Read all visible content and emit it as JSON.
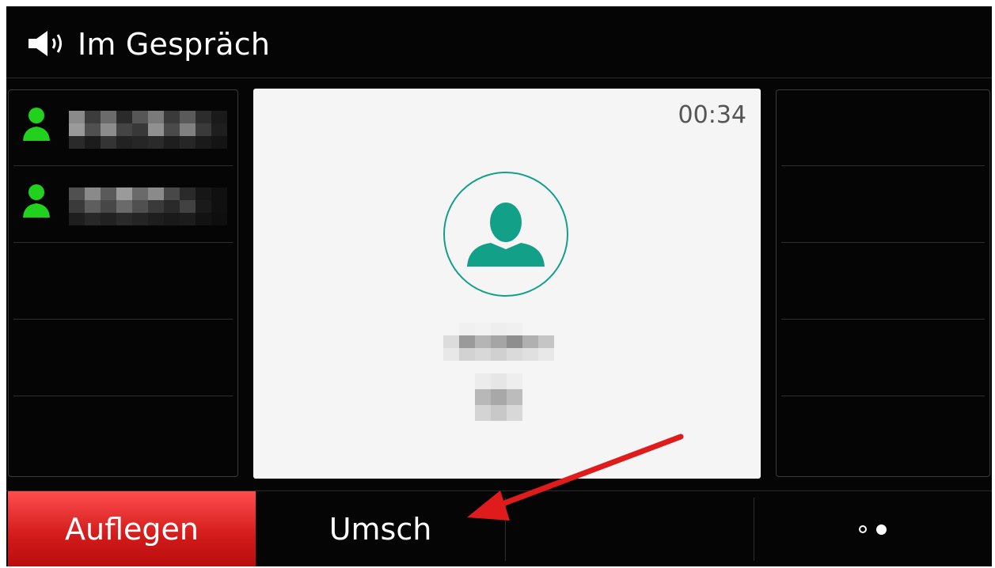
{
  "header": {
    "status_icon": "speaker-icon",
    "title": "Im Gespräch"
  },
  "call_lines": [
    {
      "icon": "person-icon",
      "icon_color": "#22d11e",
      "name_visible": false
    },
    {
      "icon": "person-icon",
      "icon_color": "#22d11e",
      "name_visible": false
    }
  ],
  "active_call": {
    "duration": "00:34",
    "avatar_icon": "person-icon",
    "avatar_color": "#13a089",
    "caller_name_visible": false
  },
  "softkeys": {
    "hangup_label": "Auflegen",
    "switch_label": "Umsch",
    "empty_label": "",
    "more_icon": "page-dots-icon"
  },
  "colors": {
    "hangup_red": "#e02020",
    "annotation_arrow": "#e01b1b",
    "background": "#050505"
  }
}
